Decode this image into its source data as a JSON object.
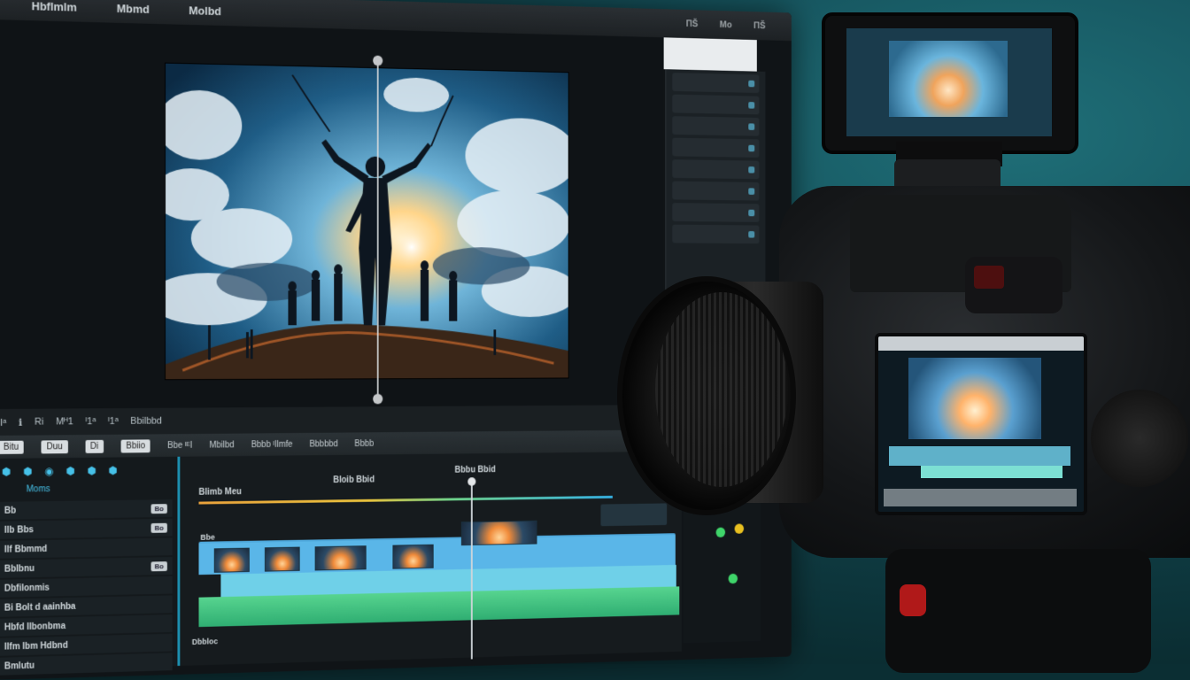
{
  "menubar": {
    "items": [
      "Hbflmlm",
      "Mbmd",
      "Molbd"
    ],
    "right_items": [
      "ΠŠ",
      "Mo",
      "ΠŠ"
    ]
  },
  "inspector": {
    "rows": [
      "",
      "",
      "",
      "",
      "",
      "",
      "",
      ""
    ]
  },
  "transport": {
    "items": [
      "Ⅰᵃ",
      "ℹ",
      "Ri",
      "Mᴴ1",
      "ᴵ1ᵃ",
      "ᴵ1ᵃ",
      "Bbilbbd"
    ]
  },
  "ruler": {
    "chips": [
      "Bitu",
      "Duu",
      "Di",
      "Bbiio"
    ],
    "labels": [
      "Bbe ᴵᴱI",
      "Mbilbd",
      "Bbbb ᴵIlmfe",
      "Bbbbbd",
      "Bbbb"
    ]
  },
  "tracks": {
    "tools": [
      "⬢",
      "⬢",
      "◉",
      "⬢",
      "⬢",
      "⬢"
    ],
    "title": "Moms",
    "items": [
      {
        "label": "Bb",
        "tag": "Bo"
      },
      {
        "label": "Ilb Bbs",
        "tag": "Bo"
      },
      {
        "label": "Ilf Bbmmd",
        "tag": ""
      },
      {
        "label": "Bblbnu",
        "tag": "Bo"
      },
      {
        "label": "Dbfilonmis",
        "tag": ""
      },
      {
        "label": "Bi Bolt d aainhba",
        "tag": ""
      },
      {
        "label": "Hbfd Ilbonbma",
        "tag": ""
      },
      {
        "label": "Ilfm lbm Hdbnd",
        "tag": ""
      },
      {
        "label": "Bmlutu",
        "tag": ""
      }
    ]
  },
  "timeline": {
    "track_label": "Blimb Meu",
    "marker_label": "Bloib Bbid",
    "marker2_label": "Bbbu Bbid",
    "video_label": "Bbe",
    "bottom_label": "Dbbloc"
  },
  "colors": {
    "accent": "#1d8fb0",
    "clip_blue": "#4ea8dc",
    "audio_green": "#2fae72"
  }
}
